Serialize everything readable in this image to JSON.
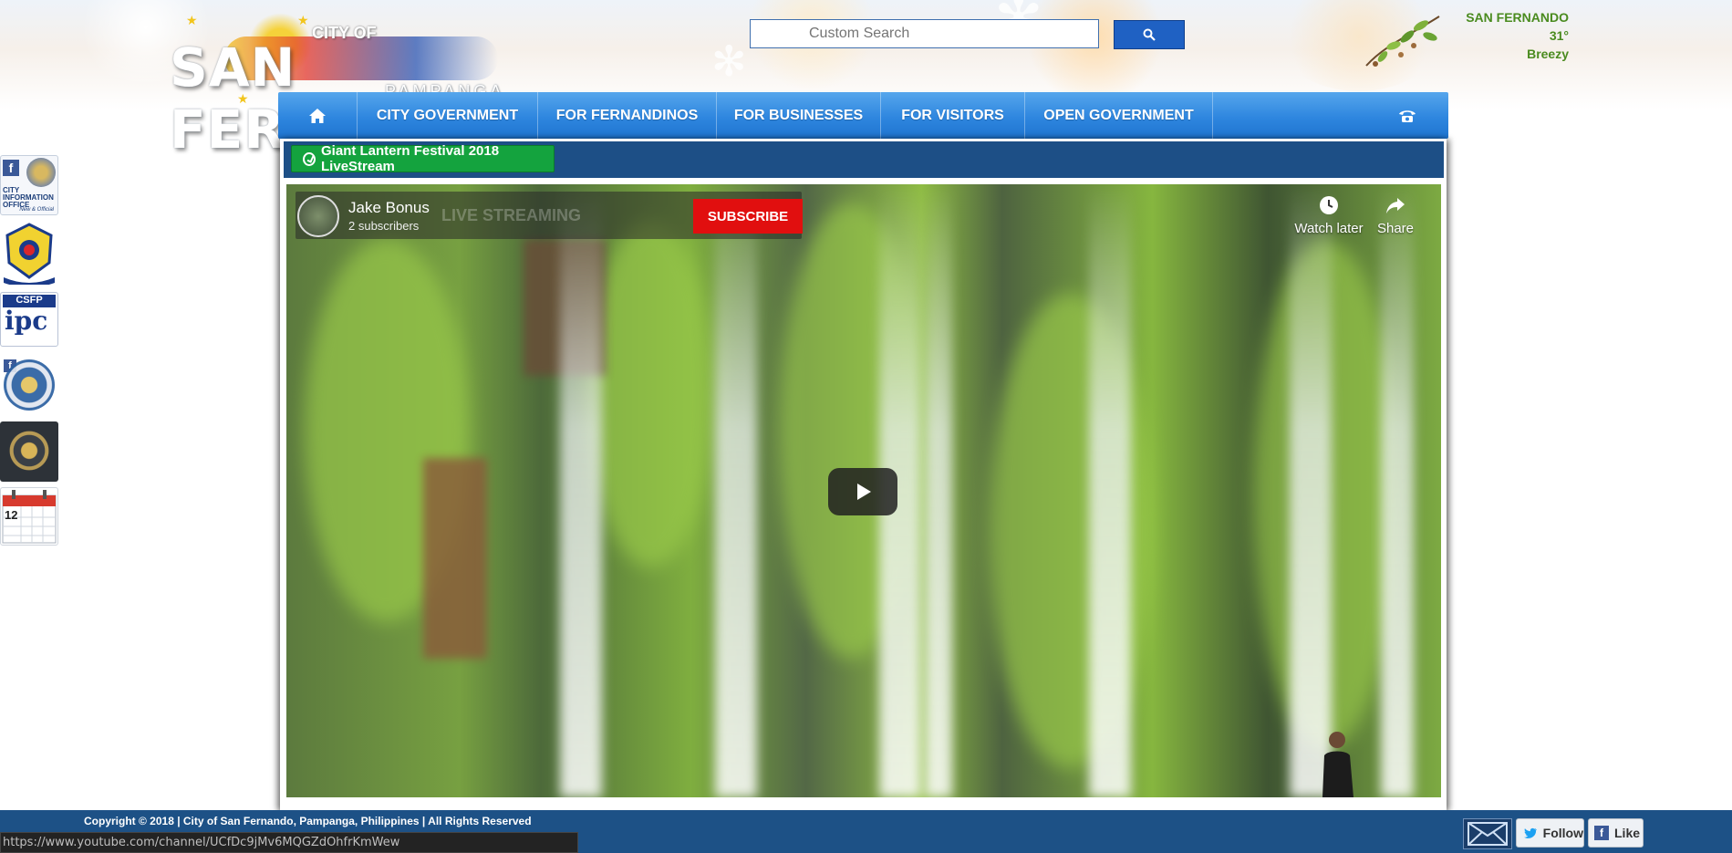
{
  "logo": {
    "city_of": "CITY OF",
    "name": "SAN FERNANDO",
    "subtitle": "PAMPANGA, PHILIPPINES"
  },
  "search": {
    "placeholder": "Custom Search",
    "icon": "search-icon"
  },
  "weather": {
    "location": "SAN FERNANDO",
    "temperature": "31°",
    "condition": "Breezy"
  },
  "nav": {
    "home_icon": "home-icon",
    "items": [
      {
        "label": "CITY GOVERNMENT"
      },
      {
        "label": "FOR FERNANDINOS"
      },
      {
        "label": "FOR BUSINESSES"
      },
      {
        "label": "FOR VISITORS"
      },
      {
        "label": "OPEN GOVERNMENT"
      }
    ],
    "phone_icon": "phone-icon"
  },
  "content": {
    "livestream_button": "Giant Lantern Festival 2018 LiveStream"
  },
  "video": {
    "channel_name": "Jake Bonus",
    "subscribers": "2 subscribers",
    "subscribe_label": "SUBSCRIBE",
    "watch_later_label": "Watch later",
    "share_label": "Share",
    "faded_title": "LIVE STREAMING"
  },
  "side_links": {
    "cio_text": "CITY INFORMATION OFFICE",
    "cio_tag": "New & Official",
    "csfp_text": "CSFP",
    "ipc_text": "ipc",
    "calendar_day": "12"
  },
  "footer": {
    "copyright": "Copyright © 2018 | City of San Fernando, Pampanga, Philippines | All Rights Reserved",
    "follow_label": "Follow",
    "like_label": "Like"
  },
  "status_bar": {
    "url": "https://www.youtube.com/channel/UCfDc9jMv6MQGZdOhfrKmWew"
  },
  "colors": {
    "nav_blue": "#2e86df",
    "content_bar": "#1d4f86",
    "live_green": "#14a33e",
    "subscribe_red": "#e10f0f",
    "weather_green": "#4a8b1f",
    "footer_blue": "#1d5186"
  }
}
